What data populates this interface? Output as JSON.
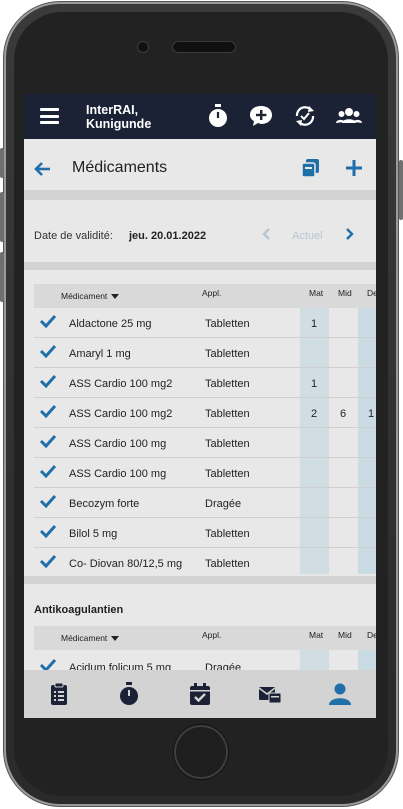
{
  "header": {
    "user_line1": "InterRAI,",
    "user_line2": "Kunigunde",
    "icons": [
      "menu-icon",
      "stopwatch-icon",
      "chat-add-icon",
      "sync-check-icon",
      "users-icon"
    ]
  },
  "page": {
    "title": "Médicaments"
  },
  "date_bar": {
    "label": "Date de validité:",
    "value": "jeu. 20.01.2022",
    "current_label": "Actuel"
  },
  "table_headers": {
    "medication": "Médicament",
    "appl": "Appl.",
    "mat": "Mat",
    "mid": "Mid",
    "de": "De"
  },
  "medications": [
    {
      "name": "Aldactone 25 mg",
      "appl": "Tabletten",
      "mat": "1",
      "mid": "",
      "de": ""
    },
    {
      "name": "Amaryl 1 mg",
      "appl": "Tabletten",
      "mat": "",
      "mid": "",
      "de": ""
    },
    {
      "name": "ASS Cardio 100 mg2",
      "appl": "Tabletten",
      "mat": "1",
      "mid": "",
      "de": ""
    },
    {
      "name": "ASS Cardio 100 mg2",
      "appl": "Tabletten",
      "mat": "2",
      "mid": "6",
      "de": "1"
    },
    {
      "name": "ASS Cardio 100 mg",
      "appl": "Tabletten",
      "mat": "",
      "mid": "",
      "de": ""
    },
    {
      "name": "ASS Cardio 100 mg",
      "appl": "Tabletten",
      "mat": "",
      "mid": "",
      "de": ""
    },
    {
      "name": "Becozym forte",
      "appl": "Dragée",
      "mat": "",
      "mid": "",
      "de": ""
    },
    {
      "name": "Bilol 5 mg",
      "appl": "Tabletten",
      "mat": "",
      "mid": "",
      "de": ""
    },
    {
      "name": "Co- Diovan 80/12,5 mg",
      "appl": "Tabletten",
      "mat": "",
      "mid": "",
      "de": ""
    }
  ],
  "group2": {
    "title": "Antikoagulantien",
    "partial_row_name": "Acidum folicum 5 mg",
    "partial_row_appl": "Dragée"
  },
  "tabbar": {
    "items": [
      "clipboard-icon",
      "stopwatch-icon",
      "calendar-check-icon",
      "mail-card-icon",
      "user-icon"
    ],
    "active_index": 4
  },
  "colors": {
    "topbar": "#1b2235",
    "accent": "#1f6fa8",
    "column_highlight": "#d0dde3"
  }
}
